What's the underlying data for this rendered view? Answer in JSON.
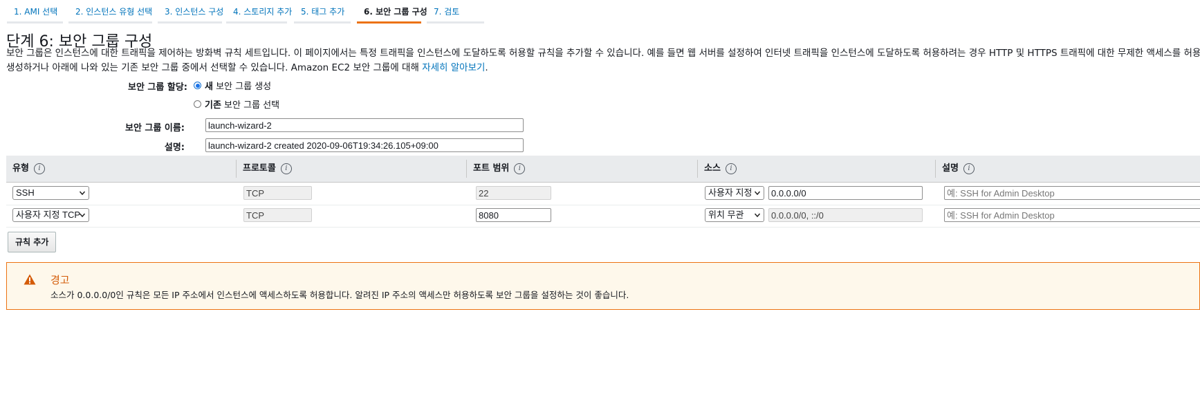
{
  "steps": [
    {
      "label": "1. AMI 선택",
      "active": false
    },
    {
      "label": "2. 인스턴스 유형 선택",
      "active": false
    },
    {
      "label": "3. 인스턴스 구성",
      "active": false
    },
    {
      "label": "4. 스토리지 추가",
      "active": false
    },
    {
      "label": "5. 태그 추가",
      "active": false
    },
    {
      "label": "6. 보안 그룹 구성",
      "active": true
    },
    {
      "label": "7. 검토",
      "active": false
    }
  ],
  "page": {
    "title": "단계 6: 보안 그룹 구성",
    "description_line1": "보안 그룹은 인스턴스에 대한 트래픽을 제어하는 방화벽 규칙 세트입니다. 이 페이지에서는 특정 트래픽을 인스턴스에 도달하도록 허용할 규칙을 추가할 수 있습니다. 예를 들면 웹 서버를 설정하여 인터넷 트래픽을 인스턴스에 도달하도록 허용하려는 경우 HTTP 및 HTTPS 트래픽에 대한 무제한 액세스를 허용하는 규칙",
    "description_line2": "생성하거나 아래에 나와 있는 기존 보안 그룹 중에서 선택할 수 있습니다. Amazon EC2 보안 그룹에 대해 ",
    "learn_more": "자세히 알아보기",
    "period": "."
  },
  "form": {
    "assign_label": "보안 그룹 할당:",
    "option_new_bold": "새",
    "option_new_rest": " 보안 그룹 생성",
    "option_existing_bold": "기존",
    "option_existing_rest": " 보안 그룹 선택",
    "name_label": "보안 그룹 이름:",
    "name_value": "launch-wizard-2",
    "desc_label": "설명:",
    "desc_value": "launch-wizard-2 created 2020-09-06T19:34:26.105+09:00"
  },
  "table": {
    "headers": {
      "type": "유형",
      "protocol": "프로토콜",
      "port": "포트 범위",
      "source": "소스",
      "description": "설명"
    },
    "rows": [
      {
        "type": "SSH",
        "protocol": "TCP",
        "port": "22",
        "source_select": "사용자 지정",
        "source_value": "0.0.0.0/0",
        "description_placeholder": "예: SSH for Admin Desktop"
      },
      {
        "type": "사용자 지정 TCP",
        "protocol": "TCP",
        "port": "8080",
        "source_select": "위치 무관",
        "source_value": "0.0.0.0/0, ::/0",
        "description_placeholder": "예: SSH for Admin Desktop"
      }
    ]
  },
  "add_rule_label": "규칙 추가",
  "warning": {
    "title": "경고",
    "text": "소스가 0.0.0.0/0인 규칙은 모든 IP 주소에서 인스턴스에 액세스하도록 허용합니다. 알려진 IP 주소의 액세스만 허용하도록 보안 그룹을 설정하는 것이 좋습니다."
  },
  "colors": {
    "link": "#0073bb",
    "accent": "#ec7211",
    "warning_bg": "#fef8eb"
  }
}
